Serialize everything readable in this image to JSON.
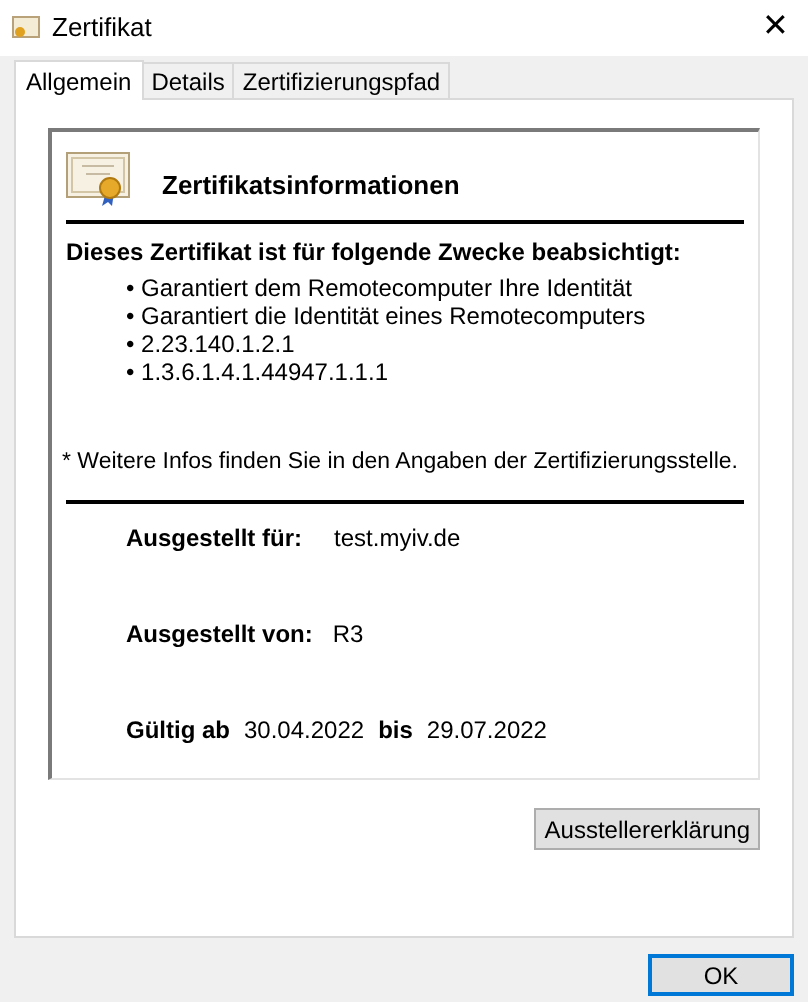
{
  "window": {
    "title": "Zertifikat"
  },
  "tabs": [
    {
      "label": "Allgemein",
      "selected": true
    },
    {
      "label": "Details",
      "selected": false
    },
    {
      "label": "Zertifizierungspfad",
      "selected": false
    }
  ],
  "info": {
    "heading": "Zertifikatsinformationen",
    "purpose_title": "Dieses Zertifikat ist für folgende Zwecke beabsichtigt:",
    "purposes": [
      "Garantiert dem Remotecomputer Ihre Identität",
      "Garantiert die Identität eines Remotecomputers",
      "2.23.140.1.2.1",
      "1.3.6.1.4.1.44947.1.1.1"
    ],
    "bullet": "•",
    "note": "* Weitere Infos finden Sie in den Angaben der Zertifizierungsstelle.",
    "issued_to_label": "Ausgestellt für:",
    "issued_to": "test.myiv.de",
    "issued_by_label": "Ausgestellt von:",
    "issued_by": "R3",
    "valid_from_label": "Gültig ab",
    "valid_from": "30.04.2022",
    "valid_to_label": "bis",
    "valid_to": "29.07.2022"
  },
  "issuer_button": "Ausstellererklärung",
  "ok_button": "OK",
  "close_glyph": "✕"
}
